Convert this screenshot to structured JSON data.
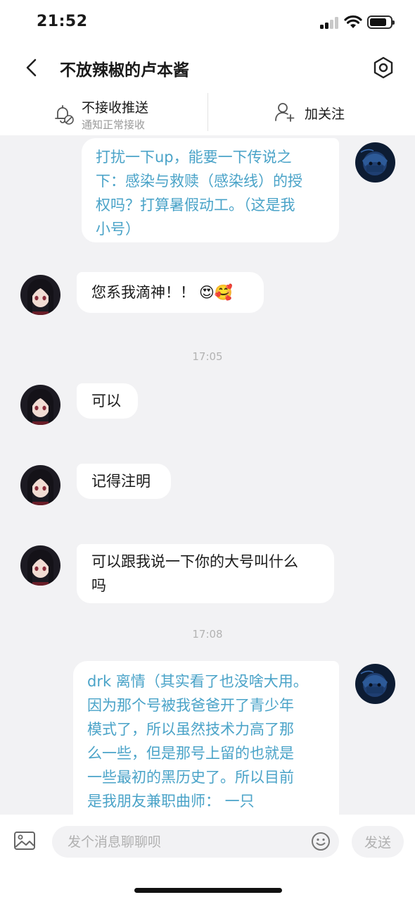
{
  "status_bar": {
    "time": "21:52"
  },
  "header": {
    "title": "不放辣椒的卢本酱",
    "push": {
      "label": "不接收推送",
      "sublabel": "通知正常接收"
    },
    "follow": {
      "label": "加关注"
    }
  },
  "messages": [
    {
      "sender": "me",
      "text": "打扰一下up，能要一下传说之\n下：感染与救赎（感染线）的授\n权吗？打算暑假动工。（这是我\n小号）"
    },
    {
      "sender": "other",
      "text": "您系我滴神！！",
      "emojis": "😍🥰"
    },
    {
      "type": "time",
      "text": "17:05"
    },
    {
      "sender": "other",
      "text": "可以"
    },
    {
      "sender": "other",
      "text": "记得注明"
    },
    {
      "sender": "other",
      "text": "可以跟我说一下你的大号叫什么\n吗"
    },
    {
      "type": "time",
      "text": "17:08"
    },
    {
      "sender": "me",
      "text": "drk 离情（其实看了也没啥大用。\n因为那个号被我爸爸开了青少年\n模式了，所以虽然技术力高了那\n么一些，但是那号上留的也就是\n一些最初的黑历史了。所以目前\n是我朋友兼职曲师： 一只\naaaam，这个人帮我发视频。）"
    }
  ],
  "input_bar": {
    "placeholder": "发个消息聊聊呗",
    "send_label": "发送"
  },
  "colors": {
    "outgoing_text": "#4aa3c8",
    "background": "#f2f2f4",
    "bubble": "#ffffff"
  },
  "icons": [
    "back-arrow-icon",
    "hexagon-settings-icon",
    "bell-off-icon",
    "user-plus-icon",
    "image-icon",
    "emoji-icon"
  ]
}
